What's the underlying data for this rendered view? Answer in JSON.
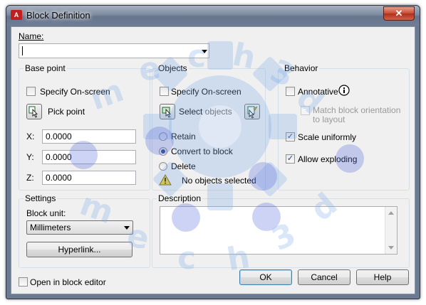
{
  "window": {
    "title": "Block Definition",
    "app_icon": "A",
    "close_glyph": "✕"
  },
  "name": {
    "label": "Name:",
    "value": ""
  },
  "base_point": {
    "title": "Base point",
    "specify_label": "Specify On-screen",
    "pick_label": "Pick point",
    "x_label": "X:",
    "x_value": "0.0000",
    "y_label": "Y:",
    "y_value": "0.0000",
    "z_label": "Z:",
    "z_value": "0.0000"
  },
  "objects": {
    "title": "Objects",
    "specify_label": "Specify On-screen",
    "select_label": "Select objects",
    "retain_label": "Retain",
    "convert_label": "Convert to block",
    "delete_label": "Delete",
    "status": "No objects selected",
    "selected_option": "convert"
  },
  "behavior": {
    "title": "Behavior",
    "annotative_label": "Annotative",
    "match_label_1": "Match block orientation",
    "match_label_2": "to layout",
    "scale_label": "Scale uniformly",
    "explode_label": "Allow exploding",
    "annotative_checked": false,
    "scale_checked": true,
    "explode_checked": true
  },
  "settings": {
    "title": "Settings",
    "unit_label": "Block unit:",
    "unit_value": "Millimeters",
    "hyperlink_label": "Hyperlink..."
  },
  "description": {
    "label": "Description",
    "value": ""
  },
  "footer": {
    "open_editor_label": "Open in block editor",
    "ok_label": "OK",
    "cancel_label": "Cancel",
    "help_label": "Help"
  },
  "icons": {
    "info": "info-icon",
    "warning": "warning-icon",
    "pick": "pick-point-icon",
    "select": "select-objects-icon",
    "quick_select": "quick-select-icon"
  },
  "watermark_letters": [
    "m",
    "e",
    "c",
    "h",
    "3",
    "d",
    "m",
    "e",
    "c",
    "h",
    "3",
    "d"
  ],
  "colors": {
    "title_bar": "#6b7a90",
    "close_button": "#c74a32",
    "dialog_bg": "#f0f0f0",
    "check": "#1f3f8f"
  }
}
